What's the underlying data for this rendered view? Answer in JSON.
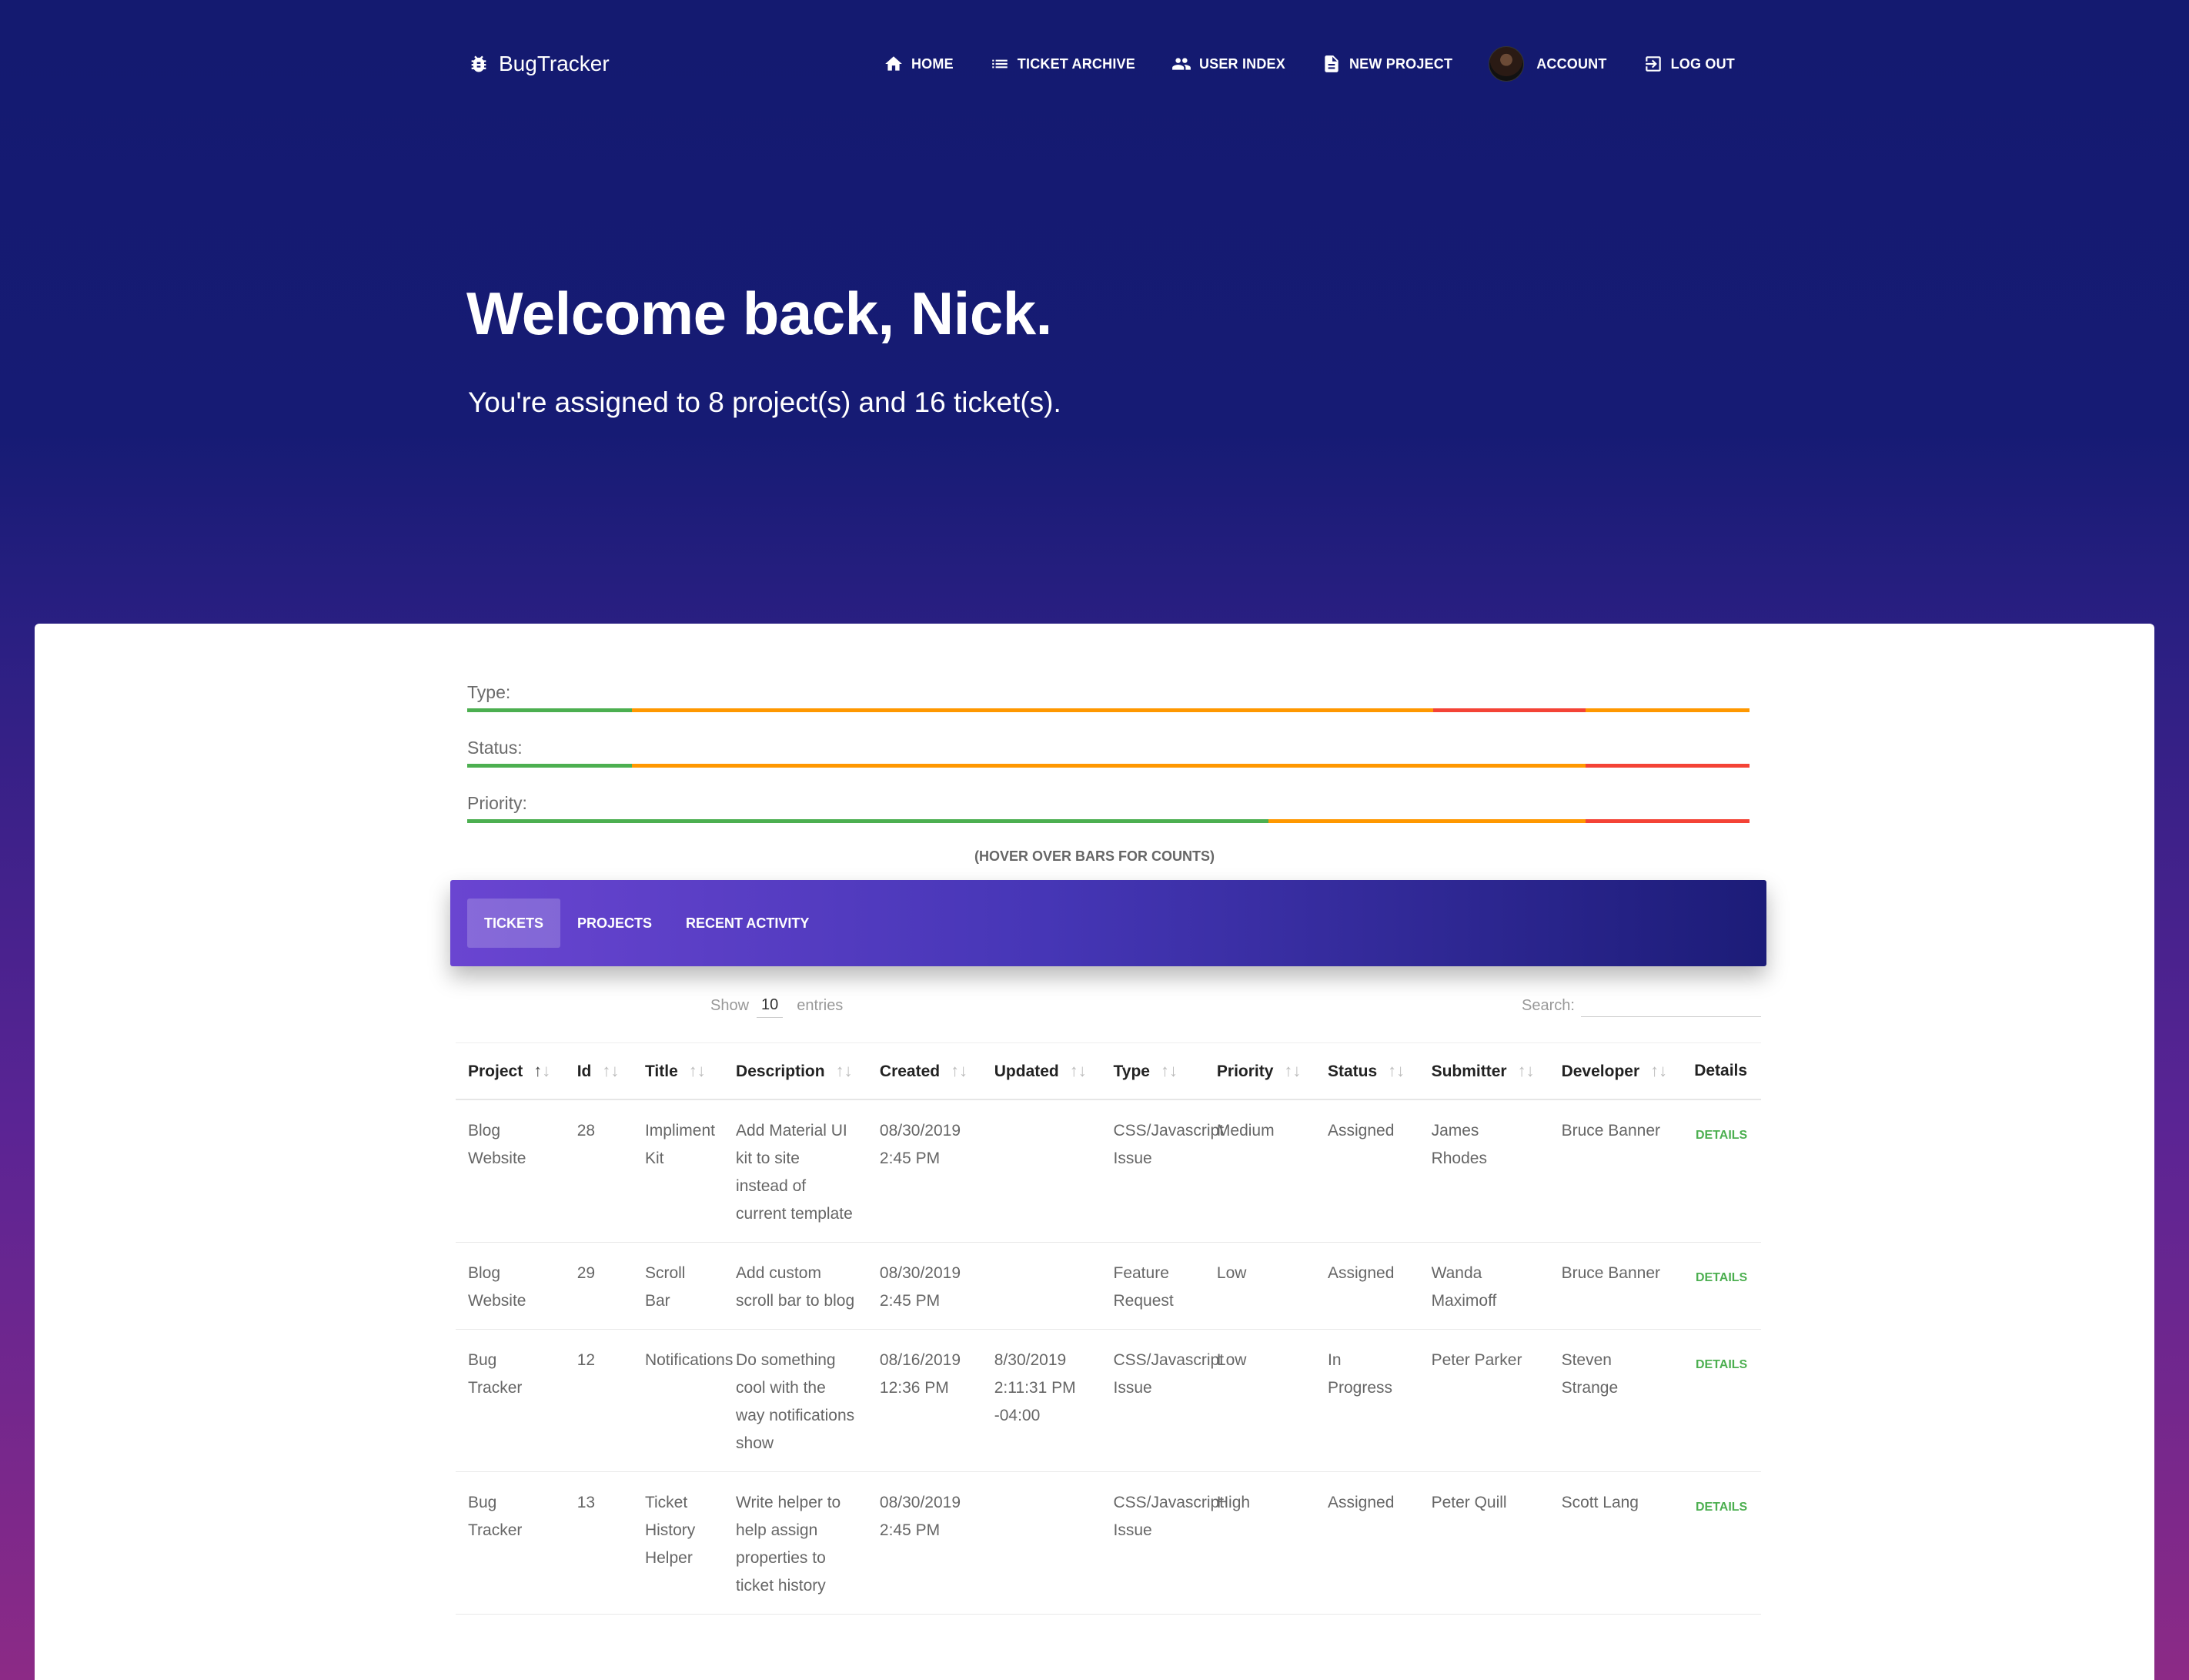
{
  "brand": {
    "name": "BugTracker"
  },
  "nav": {
    "home": "HOME",
    "ticket_archive": "TICKET ARCHIVE",
    "user_index": "USER INDEX",
    "new_project": "NEW PROJECT",
    "account": "ACCOUNT",
    "logout": "LOG OUT"
  },
  "hero": {
    "title": "Welcome back, Nick.",
    "subtitle": "You're assigned to 8 project(s) and 16 ticket(s)."
  },
  "bars": {
    "type_label": "Type:",
    "status_label": "Status:",
    "priority_label": "Priority:",
    "hover_note": "(HOVER OVER BARS FOR COUNTS)",
    "type_segments": [
      {
        "fraction": 0.1286,
        "color": "#4caf50"
      },
      {
        "fraction": 0.6248,
        "color": "#ff9800"
      },
      {
        "fraction": 0.119,
        "color": "#f44336"
      },
      {
        "fraction": 0.1276,
        "color": "#ff9800"
      }
    ],
    "status_segments": [
      {
        "fraction": 0.1286,
        "color": "#4caf50"
      },
      {
        "fraction": 0.7438,
        "color": "#ff9800"
      },
      {
        "fraction": 0.1276,
        "color": "#f44336"
      }
    ],
    "priority_segments": [
      {
        "fraction": 0.6248,
        "color": "#4caf50"
      },
      {
        "fraction": 0.2476,
        "color": "#ff9800"
      },
      {
        "fraction": 0.1276,
        "color": "#f44336"
      }
    ]
  },
  "tabs": {
    "tickets": "TICKETS",
    "projects": "PROJECTS",
    "recent_activity": "RECENT ACTIVITY"
  },
  "table_controls": {
    "show": "Show",
    "entries_value": "10",
    "entries": "entries",
    "search": "Search:"
  },
  "table": {
    "headers": [
      "Project",
      "Id",
      "Title",
      "Description",
      "Created",
      "Updated",
      "Type",
      "Priority",
      "Status",
      "Submitter",
      "Developer",
      "Details"
    ],
    "rows": [
      {
        "project": "Blog Website",
        "id": "28",
        "title": "Impliment Kit",
        "description": "Add Material UI kit to site instead of current template",
        "created": "08/30/2019 2:45 PM",
        "updated": "",
        "type": "CSS/Javascript Issue",
        "priority": "Medium",
        "status": "Assigned",
        "submitter": "James Rhodes",
        "developer": "Bruce Banner",
        "details": "DETAILS"
      },
      {
        "project": "Blog Website",
        "id": "29",
        "title": "Scroll Bar",
        "description": "Add custom scroll bar to blog",
        "created": "08/30/2019 2:45 PM",
        "updated": "",
        "type": "Feature Request",
        "priority": "Low",
        "status": "Assigned",
        "submitter": "Wanda Maximoff",
        "developer": "Bruce Banner",
        "details": "DETAILS"
      },
      {
        "project": "Bug Tracker",
        "id": "12",
        "title": "Notifications",
        "description": "Do something cool with the way notifications show",
        "created": "08/16/2019 12:36 PM",
        "updated": "8/30/2019 2:11:31 PM -04:00",
        "type": "CSS/Javascript Issue",
        "priority": "Low",
        "status": "In Progress",
        "submitter": "Peter Parker",
        "developer": "Steven Strange",
        "details": "DETAILS"
      },
      {
        "project": "Bug Tracker",
        "id": "13",
        "title": "Ticket History Helper",
        "description": "Write helper to help assign properties to ticket history",
        "created": "08/30/2019 2:45 PM",
        "updated": "",
        "type": "CSS/Javascript Issue",
        "priority": "High",
        "status": "Assigned",
        "submitter": "Peter Quill",
        "developer": "Scott Lang",
        "details": "DETAILS"
      }
    ]
  }
}
